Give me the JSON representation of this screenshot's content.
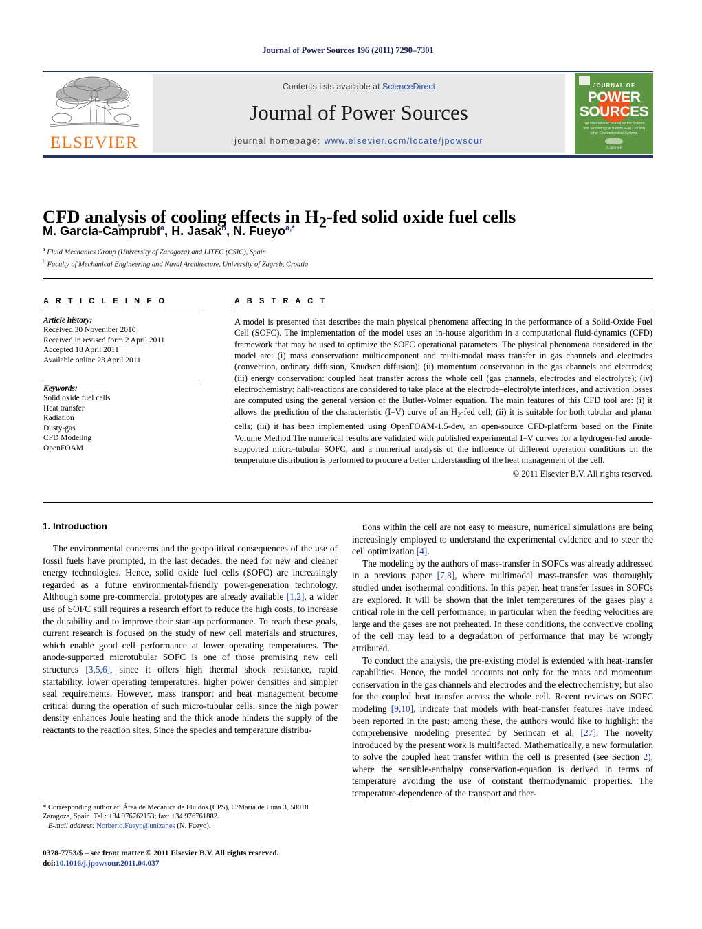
{
  "running_head": "Journal of Power Sources 196 (2011) 7290–7301",
  "masthead": {
    "elsevier_wordmark": "ELSEVIER",
    "contents_prefix": "Contents lists available at ",
    "contents_link": "ScienceDirect",
    "journal_title": "Journal of Power Sources",
    "homepage_prefix": "journal homepage: ",
    "homepage_url": "www.elsevier.com/locate/jpowsour",
    "cover": {
      "line1": "JOURNAL OF",
      "line2": "POWER",
      "line3": "SOURCES",
      "subtitle": "The International Journal on the Science and Technology of Battery, Fuel Cell and other Electrochemical Systems",
      "footer": "ELSEVIER"
    }
  },
  "article": {
    "title_pre": "CFD analysis of cooling effects in H",
    "title_sub": "2",
    "title_post": "-fed solid oxide fuel cells",
    "authors": [
      {
        "name": "M. García-Camprubí",
        "sup": "a"
      },
      {
        "name": "H. Jasak",
        "sup": "b"
      },
      {
        "name": "N. Fueyo",
        "sup": "a,*"
      }
    ],
    "affiliations": [
      {
        "marker": "a",
        "text": "Fluid Mechanics Group (University of Zaragoza) and LITEC (CSIC), Spain"
      },
      {
        "marker": "b",
        "text": "Faculty of Mechanical Engineering and Naval Architecture, University of Zagreb, Croatia"
      }
    ]
  },
  "info": {
    "heading": "A R T I C L E   I N F O",
    "history_label": "Article history:",
    "history": [
      "Received 30 November 2010",
      "Received in revised form 2 April 2011",
      "Accepted 18 April 2011",
      "Available online 23 April 2011"
    ],
    "keywords_label": "Keywords:",
    "keywords": [
      "Solid oxide fuel cells",
      "Heat transfer",
      "Radiation",
      "Dusty-gas",
      "CFD Modeling",
      "OpenFOAM"
    ]
  },
  "abstract": {
    "heading": "A B S T R A C T",
    "text": "A model is presented that describes the main physical phenomena affecting in the performance of a Solid-Oxide Fuel Cell (SOFC). The implementation of the model uses an in-house algorithm in a computational fluid-dynamics (CFD) framework that may be used to optimize the SOFC operational parameters. The physical phenomena considered in the model are: (i) mass conservation: multicomponent and multi-modal mass transfer in gas channels and electrodes (convection, ordinary diffusion, Knudsen diffusion); (ii) momentum conservation in the gas channels and electrodes; (iii) energy conservation: coupled heat transfer across the whole cell (gas channels, electrodes and electrolyte); (iv) electrochemistry: half-reactions are considered to take place at the electrode–electrolyte interfaces, and activation losses are computed using the general version of the Butler-Volmer equation. The main features of this CFD tool are: (i) it allows the prediction of the characteristic (I–V) curve of an H2-fed cell; (ii) it is suitable for both tubular and planar cells; (iii) it has been implemented using OpenFOAM-1.5-dev, an open-source CFD-platform based on the Finite Volume Method.The numerical results are validated with published experimental I–V curves for a hydrogen-fed anode-supported micro-tubular SOFC, and a numerical analysis of the influence of different operation conditions on the temperature distribution is performed to procure a better understanding of the heat management of the cell.",
    "copyright": "© 2011 Elsevier B.V. All rights reserved."
  },
  "body": {
    "section_heading": "1.  Introduction",
    "left_paragraph_1": "The environmental concerns and the geopolitical consequences of the use of fossil fuels have prompted, in the last decades, the need for new and cleaner energy technologies. Hence, solid oxide fuel cells (SOFC) are increasingly regarded as a future environmental-friendly power-generation technology. Although some pre-commercial prototypes are already available [1,2], a wider use of SOFC still requires a research effort to reduce the high costs, to increase the durability and to improve their start-up performance. To reach these goals, current research is focused on the study of new cell materials and structures, which enable good cell performance at lower operating temperatures. The anode-supported microtubular SOFC is one of those promising new cell structures [3,5,6], since it offers high thermal shock resistance, rapid startability, lower operating temperatures, higher power densities and simpler seal requirements. However, mass transport and heat management become critical during the operation of such micro-tubular cells, since the high power density enhances Joule heating and the thick anode hinders the supply of the reactants to the reaction sites. Since the species and temperature distribu-",
    "right_paragraph_1": "tions within the cell are not easy to measure, numerical simulations are being increasingly employed to understand the experimental evidence and to steer the cell optimization [4].",
    "right_paragraph_2": "The modeling by the authors of mass-transfer in SOFCs was already addressed in a previous paper [7,8], where multimodal mass-transfer was thoroughly studied under isothermal conditions. In this paper, heat transfer issues in SOFCs are explored. It will be shown that the inlet temperatures of the gases play a critical role in the cell performance, in particular when the feeding velocities are large and the gases are not preheated. In these conditions, the convective cooling of the cell may lead to a degradation of performance that may be wrongly attributed.",
    "right_paragraph_3": "To conduct the analysis, the pre-existing model is extended with heat-transfer capabilities. Hence, the model accounts not only for the mass and momentum conservation in the gas channels and electrodes and the electrochemistry; but also for the coupled heat transfer across the whole cell. Recent reviews on SOFC modeling [9,10], indicate that models with heat-transfer features have indeed been reported in the past; among these, the authors would like to highlight the comprehensive modeling presented by Serincan et al. [27]. The novelty introduced by the present work is multifacted. Mathematically, a new formulation to solve the coupled heat transfer within the cell is presented (see Section 2), where the sensible-enthalpy conservation-equation is derived in terms of temperature avoiding the use of constant thermodynamic properties. The temperature-dependence of the transport and ther-"
  },
  "footnotes": {
    "corresponding": "* Corresponding author at: Área de Mecánica de Fluidos (CPS), C/María de Luna 3, 50018 Zaragoza, Spain. Tel.: +34 976762153; fax: +34 976761882.",
    "email_label": "E-mail address:",
    "email": "Norberto.Fueyo@unizar.es",
    "email_suffix": "(N. Fueyo).",
    "imprint": "0378-7753/$ – see front matter © 2011 Elsevier B.V. All rights reserved.",
    "doi_label": "doi:",
    "doi": "10.1016/j.jpowsour.2011.04.037"
  },
  "colors": {
    "rule_navy": "#24306a",
    "link_blue": "#2b4eaa",
    "ref_blue": "#1f3fa0",
    "elsevier_orange": "#E87722",
    "cover_green": "#5d9642",
    "cover_orange": "#e8541c",
    "masthead_grey": "#e7e8ea"
  }
}
